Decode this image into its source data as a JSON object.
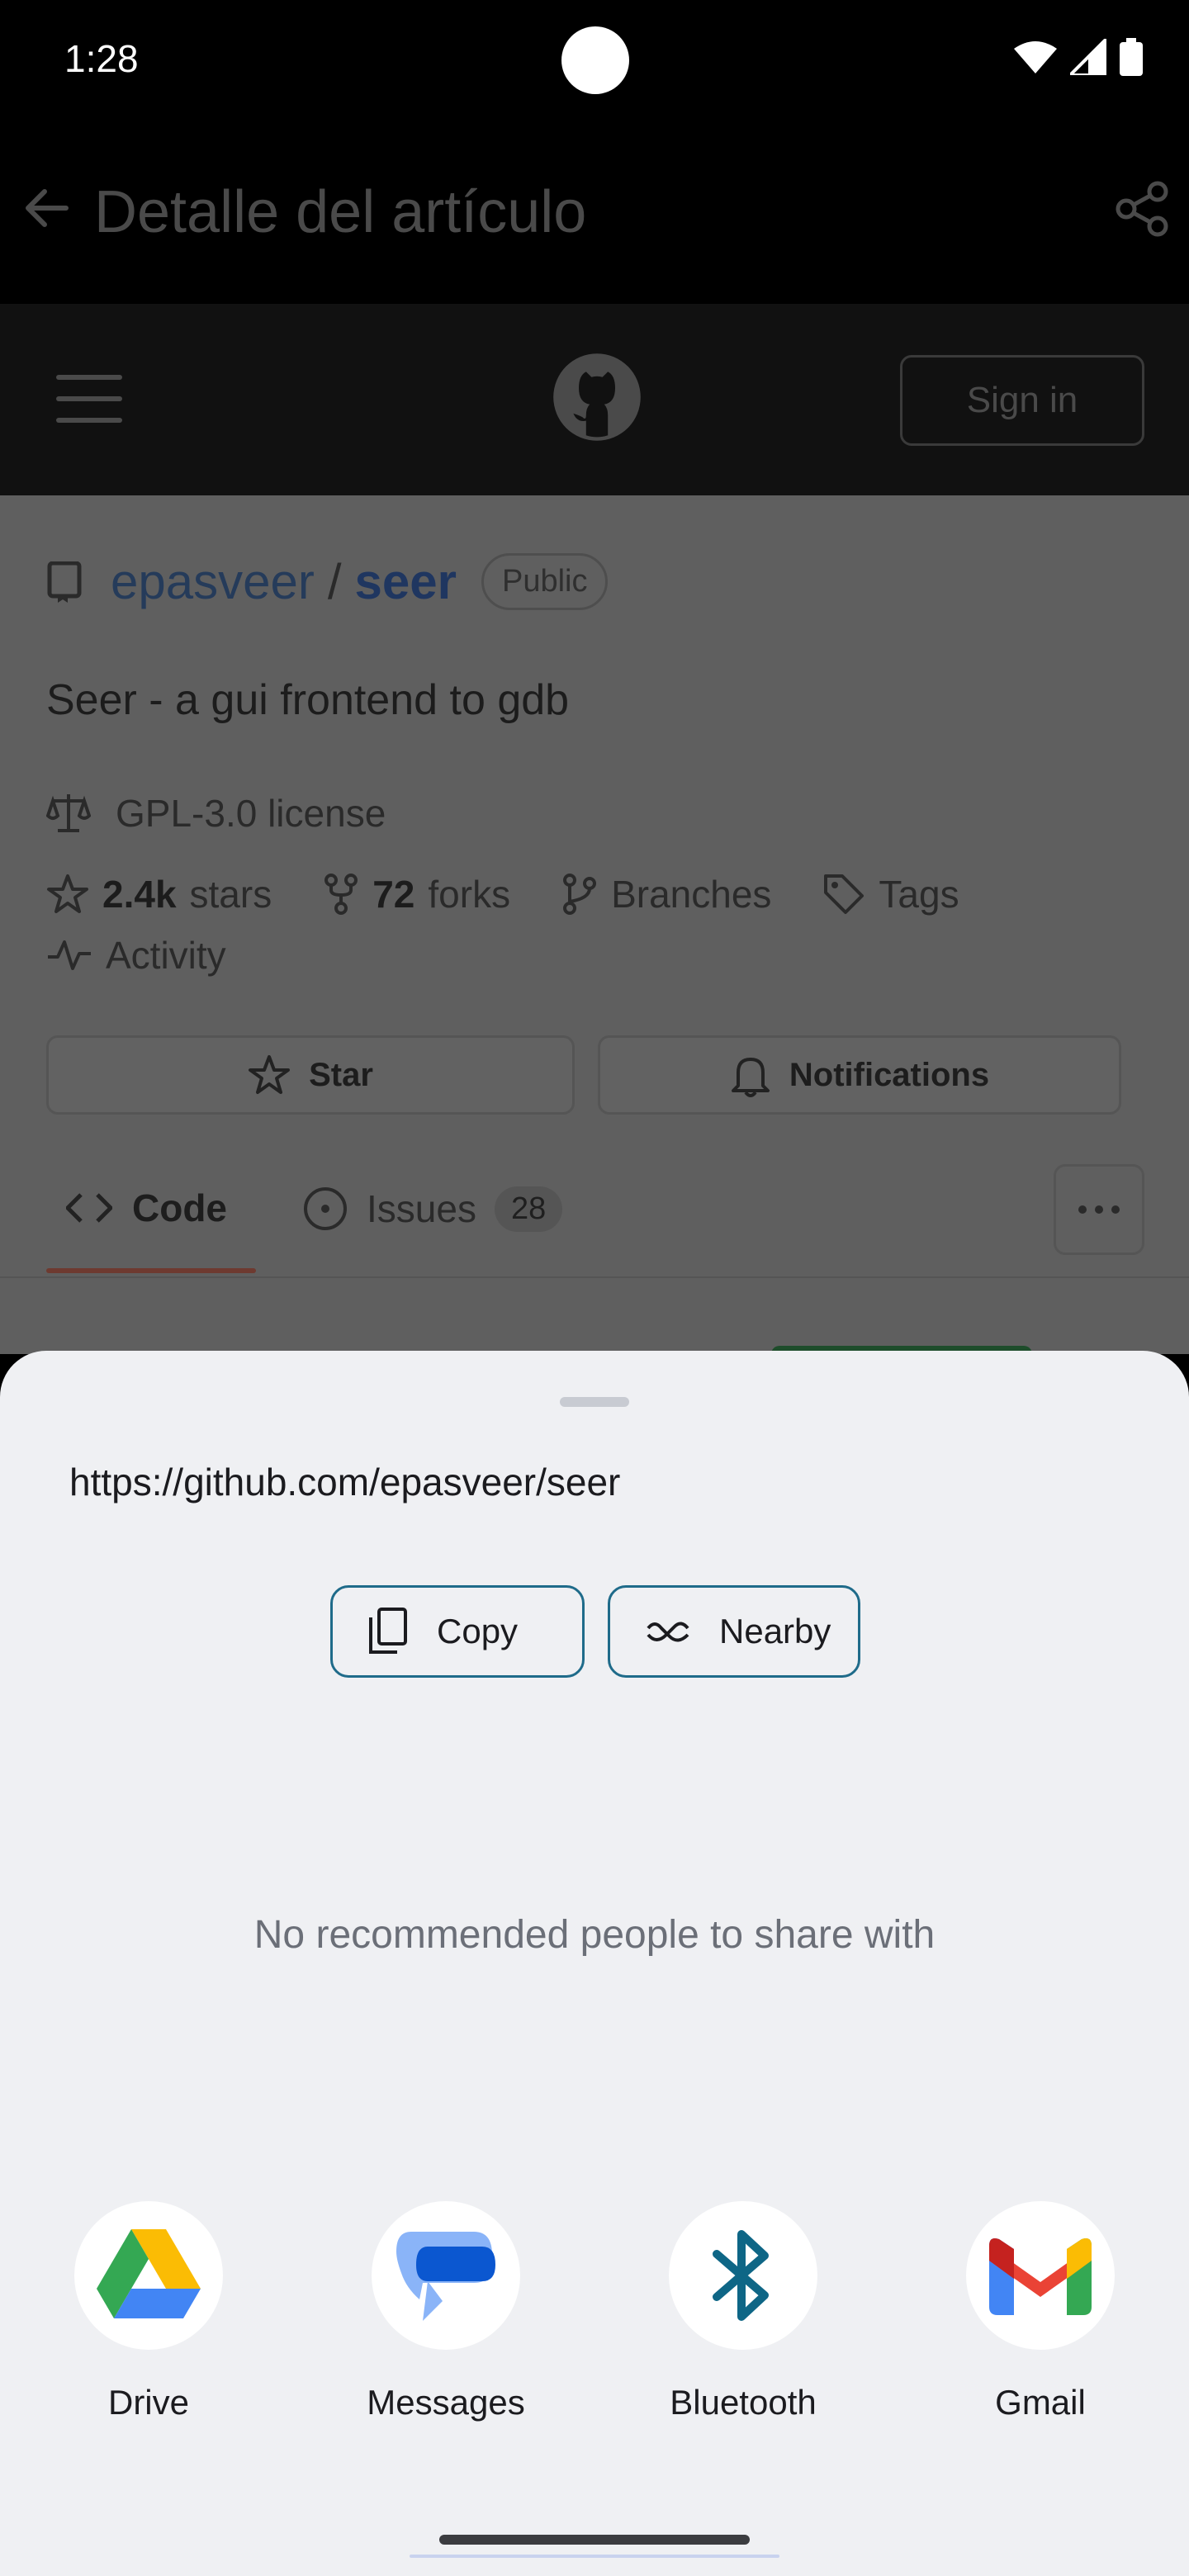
{
  "status_bar": {
    "time": "1:28"
  },
  "app_bar": {
    "title": "Detalle del artículo"
  },
  "github": {
    "sign_in": "Sign in",
    "owner": "epasveer",
    "slash": "/",
    "repo": "seer",
    "visibility": "Public",
    "description": "Seer - a gui frontend to gdb",
    "license": "GPL-3.0 license",
    "stars_count": "2.4k",
    "stars_label": "stars",
    "forks_count": "72",
    "forks_label": "forks",
    "branches": "Branches",
    "tags": "Tags",
    "activity": "Activity",
    "star_button": "Star",
    "notifications_button": "Notifications",
    "tabs": {
      "code": "Code",
      "issues": "Issues",
      "issues_count": "28"
    }
  },
  "share_sheet": {
    "url": "https://github.com/epasveer/seer",
    "copy": "Copy",
    "nearby": "Nearby",
    "empty_people": "No recommended people to share with",
    "apps": [
      {
        "label": "Drive",
        "icon": "drive-icon"
      },
      {
        "label": "Messages",
        "icon": "messages-icon"
      },
      {
        "label": "Bluetooth",
        "icon": "bluetooth-icon"
      },
      {
        "label": "Gmail",
        "icon": "gmail-icon"
      }
    ]
  },
  "colors": {
    "sheet_bg": "#eff0f3",
    "chip_border": "#1f6b8a",
    "scrim": "#5f5f5f"
  }
}
